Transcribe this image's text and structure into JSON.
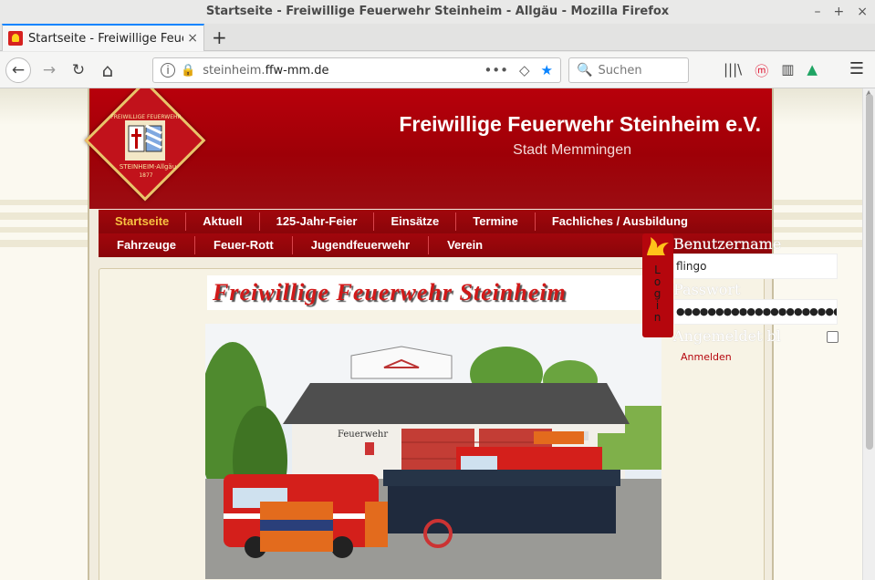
{
  "window": {
    "title": "Startseite - Freiwillige Feuerwehr Steinheim - Allgäu - Mozilla Firefox",
    "controls": [
      "–",
      "+",
      "×"
    ]
  },
  "tab": {
    "title": "Startseite - Freiwillige Feue",
    "close": "×"
  },
  "newtab": "+",
  "nav": {
    "back_icon": "←",
    "forward_icon": "→",
    "reload_icon": "↻",
    "home_icon": "⌂",
    "url_host_prefix": "steinheim.",
    "url_host_main": "ffw-mm.de",
    "info_icon": "i",
    "insecure_icon": "🔒",
    "page_actions_icon": "•••",
    "pocket_icon": "◇",
    "bookmark_icon": "★",
    "search_placeholder": "Suchen",
    "search_icon": "🔍",
    "library_icon": "|||\\",
    "pocket_r_icon": "ⓜ",
    "sidebar_icon": "▥",
    "drive_icon": "▲",
    "menu_icon": "☰"
  },
  "site": {
    "title": "Freiwillige Feuerwehr Steinheim e.V.",
    "subtitle": "Stadt Memmingen",
    "logo_top_text": "FREIWILLIGE FEUERWEHR",
    "logo_bottom_text": "STEINHEIM·Allgäu",
    "logo_years": "1877",
    "menu_row1": [
      "Startseite",
      "Aktuell",
      "125-Jahr-Feier",
      "Einsätze",
      "Termine",
      "Fachliches / Ausbildung"
    ],
    "menu_row2": [
      "Fahrzeuge",
      "Feuer-Rott",
      "Jugendfeuerwehr",
      "Verein"
    ],
    "active_item": "Startseite",
    "banner_text": "Freiwillige Feuerwehr Steinheim",
    "building_sign": "Feuerwehr"
  },
  "login": {
    "tab_label": "L o g i n",
    "username_label": "Benutzername",
    "username_value": "flingo",
    "password_label": "Passwort",
    "password_value": "●●●●●●●●●●●●●●●●●●●●●●●●",
    "remember_label": "Angemeldet bl",
    "submit_link": "Anmelden"
  },
  "colors": {
    "header_red": "#b8000b",
    "active_menu": "#f7c241",
    "firefox_accent": "#0a84ff"
  }
}
